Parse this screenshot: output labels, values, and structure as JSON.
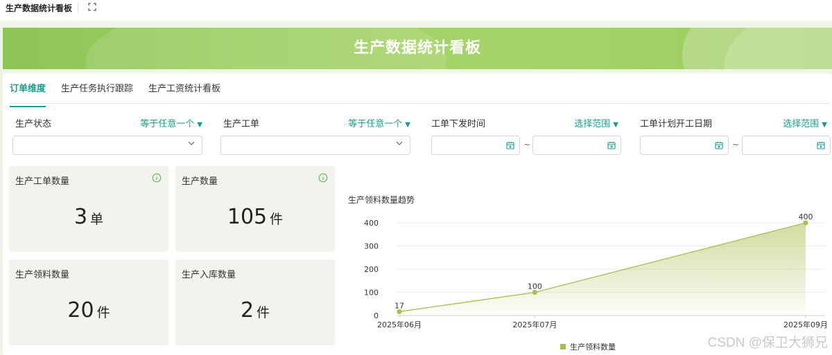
{
  "window": {
    "title": "生产数据统计看板"
  },
  "banner": {
    "title": "生产数据统计看板"
  },
  "tabs": [
    {
      "label": "订单维度",
      "active": true
    },
    {
      "label": "生产任务执行跟踪",
      "active": false
    },
    {
      "label": "生产工资统计看板",
      "active": false
    }
  ],
  "filters": [
    {
      "label": "生产状态",
      "operator": "等于任意一个",
      "type": "select",
      "value": ""
    },
    {
      "label": "生产工单",
      "operator": "等于任意一个",
      "type": "select",
      "value": ""
    },
    {
      "label": "工单下发时间",
      "operator": "选择范围",
      "type": "daterange",
      "separator": "~",
      "start": "",
      "end": ""
    },
    {
      "label": "工单计划开工日期",
      "operator": "选择范围",
      "type": "daterange",
      "separator": "~",
      "start": "",
      "end": ""
    }
  ],
  "stats": [
    {
      "label": "生产工单数量",
      "value": "3",
      "unit": "单",
      "info_icon": true
    },
    {
      "label": "生产数量",
      "value": "105",
      "unit": "件",
      "info_icon": true
    },
    {
      "label": "生产领料数量",
      "value": "20",
      "unit": "件",
      "info_icon": false
    },
    {
      "label": "生产入库数量",
      "value": "2",
      "unit": "件",
      "info_icon": false
    }
  ],
  "chart_title": "生产领料数量趋势",
  "chart_data": {
    "type": "area",
    "x": [
      "2025年06月",
      "2025年07月",
      "2025年09月"
    ],
    "series": [
      {
        "name": "生产领料数量",
        "values": [
          17,
          100,
          400
        ],
        "color": "#a8bf4f"
      }
    ],
    "ylim": [
      0,
      400
    ],
    "yticks": [
      0,
      100,
      200,
      300,
      400
    ],
    "legend": "bottom-center",
    "grid": true
  },
  "colors": {
    "accent": "#1a9c8a",
    "banner": "#9fd061",
    "card_bg": "#f2f3ed",
    "info": "#5cb85c"
  },
  "watermark": "CSDN @保卫大狮兄"
}
